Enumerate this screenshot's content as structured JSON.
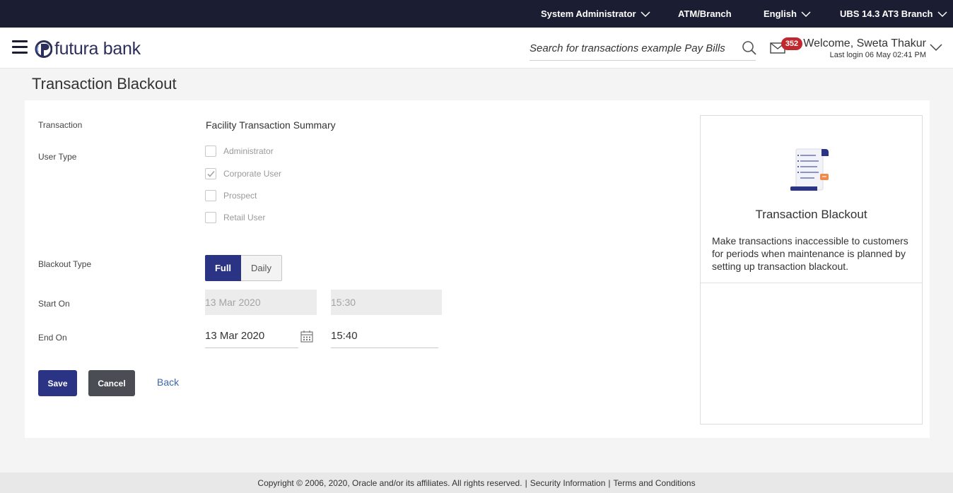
{
  "topbar": {
    "role": "System Administrator",
    "location": "ATM/Branch",
    "language": "English",
    "branch": "UBS 14.3 AT3 Branch"
  },
  "header": {
    "logo_text": "futura bank",
    "search_placeholder": "Search for transactions example Pay Bills",
    "mail_count": "352",
    "welcome": "Welcome, Sweta Thakur",
    "last_login": "Last login 06 May 02:41 PM"
  },
  "page": {
    "title": "Transaction Blackout"
  },
  "form": {
    "transaction_label": "Transaction",
    "transaction_value": "Facility Transaction Summary",
    "user_type_label": "User Type",
    "user_types": [
      {
        "label": "Administrator",
        "checked": false
      },
      {
        "label": "Corporate User",
        "checked": true
      },
      {
        "label": "Prospect",
        "checked": false
      },
      {
        "label": "Retail User",
        "checked": false
      }
    ],
    "blackout_type_label": "Blackout Type",
    "blackout_full": "Full",
    "blackout_daily": "Daily",
    "blackout_selected": "Full",
    "start_on_label": "Start On",
    "start_date": "13 Mar 2020",
    "start_time": "15:30",
    "end_on_label": "End On",
    "end_date": "13 Mar 2020",
    "end_time": "15:40"
  },
  "actions": {
    "save": "Save",
    "cancel": "Cancel",
    "back": "Back"
  },
  "help": {
    "title": "Transaction Blackout",
    "text": "Make transactions inaccessible to customers for periods when maintenance is planned by setting up transaction blackout."
  },
  "footer": {
    "copyright": "Copyright © 2006, 2020, Oracle and/or its affiliates. All rights reserved.",
    "security": "Security Information",
    "terms": "Terms and Conditions"
  },
  "colors": {
    "topbar_bg": "#1b1e32",
    "primary": "#2b3385",
    "badge": "#c0282d"
  }
}
